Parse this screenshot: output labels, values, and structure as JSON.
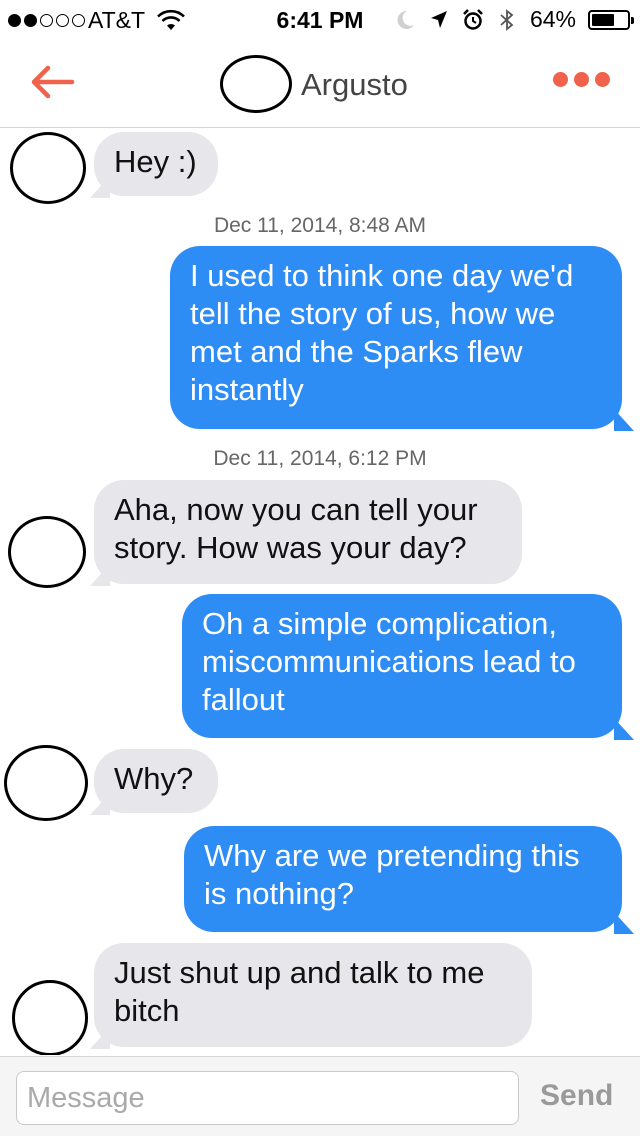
{
  "status_bar": {
    "signal_bars": 2,
    "signal_total": 5,
    "carrier": "AT&T",
    "time": "6:41 PM",
    "battery_text": "64%",
    "battery_level": 0.64,
    "icons": [
      "wifi-icon",
      "do-not-disturb-icon",
      "location-arrow-icon",
      "alarm-icon",
      "bluetooth-icon",
      "battery-icon"
    ]
  },
  "header": {
    "back_icon": "arrow-left-icon",
    "title": "Argusto",
    "more_icon": "three-dots-icon"
  },
  "messages": [
    {
      "direction": "in",
      "lines": [
        "Hey :)"
      ]
    },
    {
      "timestamp": "Dec 11, 2014, 8:48 AM"
    },
    {
      "direction": "out",
      "lines": [
        "I used to think one day we'd",
        "tell the story of us, how we",
        "met and the Sparks flew",
        "instantly"
      ]
    },
    {
      "timestamp": "Dec 11, 2014, 6:12 PM"
    },
    {
      "direction": "in",
      "lines": [
        "Aha, now you can tell your",
        "story.  How was your day?"
      ]
    },
    {
      "direction": "out",
      "lines": [
        "Oh a simple complication,",
        "miscommunications lead to",
        "fallout"
      ]
    },
    {
      "direction": "in",
      "lines": [
        "Why?"
      ]
    },
    {
      "direction": "out",
      "lines": [
        "Why are we pretending this",
        "is nothing?"
      ]
    },
    {
      "direction": "in",
      "lines": [
        "Just shut up and talk to me",
        "bitch"
      ]
    }
  ],
  "composer": {
    "placeholder": "Message",
    "value": "",
    "send_label": "Send"
  },
  "colors": {
    "accent": "#f0624b",
    "outgoing_bubble": "#2e8cf5",
    "incoming_bubble": "#e6e6eb",
    "send_disabled": "#9a9a9a"
  }
}
